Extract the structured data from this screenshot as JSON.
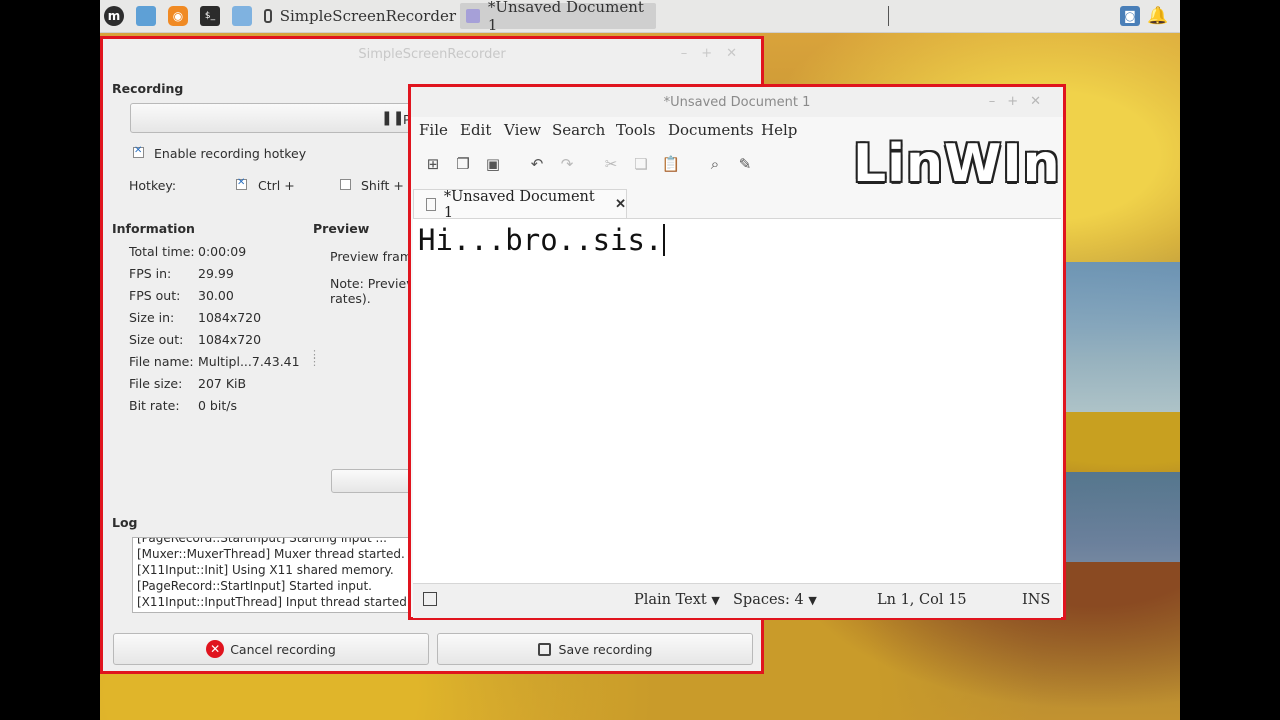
{
  "taskbar": {
    "tasks": [
      {
        "label": "SimpleScreenRecorder",
        "icon": "camera-icon"
      },
      {
        "label": "*Unsaved Document 1",
        "icon": "text-editor-icon"
      }
    ],
    "tray": [
      "screenshot-icon",
      "bell-icon"
    ]
  },
  "ssr": {
    "title": "SimpleScreenRecorder",
    "recording_heading": "Recording",
    "pause_label": "P",
    "hotkey_enable_label": "Enable recording hotkey",
    "hotkey_label": "Hotkey:",
    "ctrl_label": "Ctrl +",
    "shift_label": "Shift +",
    "information_heading": "Information",
    "preview_heading": "Preview",
    "preview_frame_label": "Preview fram",
    "preview_note": "Note: Previev",
    "preview_note2": "rates).",
    "info": [
      {
        "label": "Total time:",
        "value": "0:00:09"
      },
      {
        "label": "FPS in:",
        "value": "29.99"
      },
      {
        "label": "FPS out:",
        "value": "30.00"
      },
      {
        "label": "Size in:",
        "value": "1084x720"
      },
      {
        "label": "Size out:",
        "value": "1084x720"
      },
      {
        "label": "File name:",
        "value": "Multipl...7.43.41"
      },
      {
        "label": "File size:",
        "value": "207 KiB"
      },
      {
        "label": "Bit rate:",
        "value": "0 bit/s"
      }
    ],
    "log_heading": "Log",
    "log_lines": [
      "[PageRecord::StartInput] Starting input ...",
      "[Muxer::MuxerThread] Muxer thread started.",
      "[X11Input::Init] Using X11 shared memory.",
      "[PageRecord::StartInput] Started input.",
      "[X11Input::InputThread] Input thread started."
    ],
    "cancel_label": "Cancel recording",
    "save_label": "Save recording",
    "colors": {
      "frame": "#e0141e",
      "cancel_icon": "#e0141e"
    }
  },
  "editor": {
    "title": "*Unsaved Document 1",
    "menu": [
      "File",
      "Edit",
      "View",
      "Search",
      "Tools",
      "Documents",
      "Help"
    ],
    "logo_text": "LinWIn",
    "tab_label": "*Unsaved Document 1",
    "content": "Hi...bro..sis.",
    "status": {
      "language": "Plain Text",
      "spaces": "Spaces: 4",
      "position": "Ln 1, Col 15",
      "mode": "INS"
    }
  }
}
